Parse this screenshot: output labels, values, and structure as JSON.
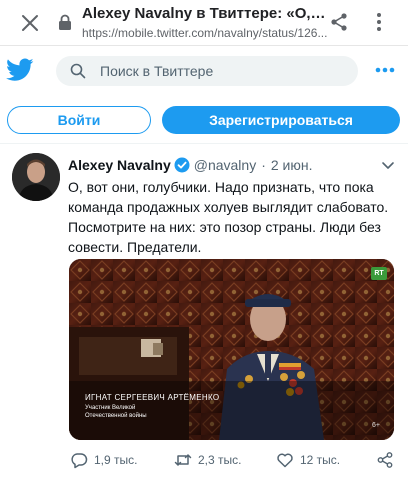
{
  "browser": {
    "title": "Alexey Navalny в Твиттере: «О, вот они, голубчики",
    "url": "https://mobile.twitter.com/navalny/status/126..."
  },
  "header": {
    "search_placeholder": "Поиск в Твиттере"
  },
  "auth": {
    "login_label": "Войти",
    "signup_label": "Зарегистрироваться"
  },
  "tweet": {
    "author_name": "Alexey Navalny",
    "handle": "@navalny",
    "separator": "·",
    "date": "2 июн.",
    "text": "О, вот они, голубчики. Надо признать, что пока команда продажных холуев выглядит слабовато. Посмотрите на них: это позор страны. Люди без совести. Предатели.",
    "media": {
      "channel_badge": "RT",
      "caption_name": "ИГНАТ СЕРГЕЕВИЧ АРТЁМЕНКО",
      "caption_sub": "Участник Великой Отечественной войны",
      "age_rating": "6+"
    },
    "actions": {
      "replies": "1,9 тыс.",
      "retweets": "2,3 тыс.",
      "likes": "12 тыс."
    }
  },
  "colors": {
    "twitter_blue": "#1d9bf0",
    "text_primary": "#0f1419",
    "text_secondary": "#536471"
  },
  "icons": [
    "close-icon",
    "lock-icon",
    "share-icon",
    "more-vert-icon",
    "twitter-logo",
    "search-icon",
    "more-horiz-icon",
    "verified-icon",
    "chevron-down-icon",
    "reply-icon",
    "retweet-icon",
    "like-icon",
    "share-tweet-icon"
  ]
}
